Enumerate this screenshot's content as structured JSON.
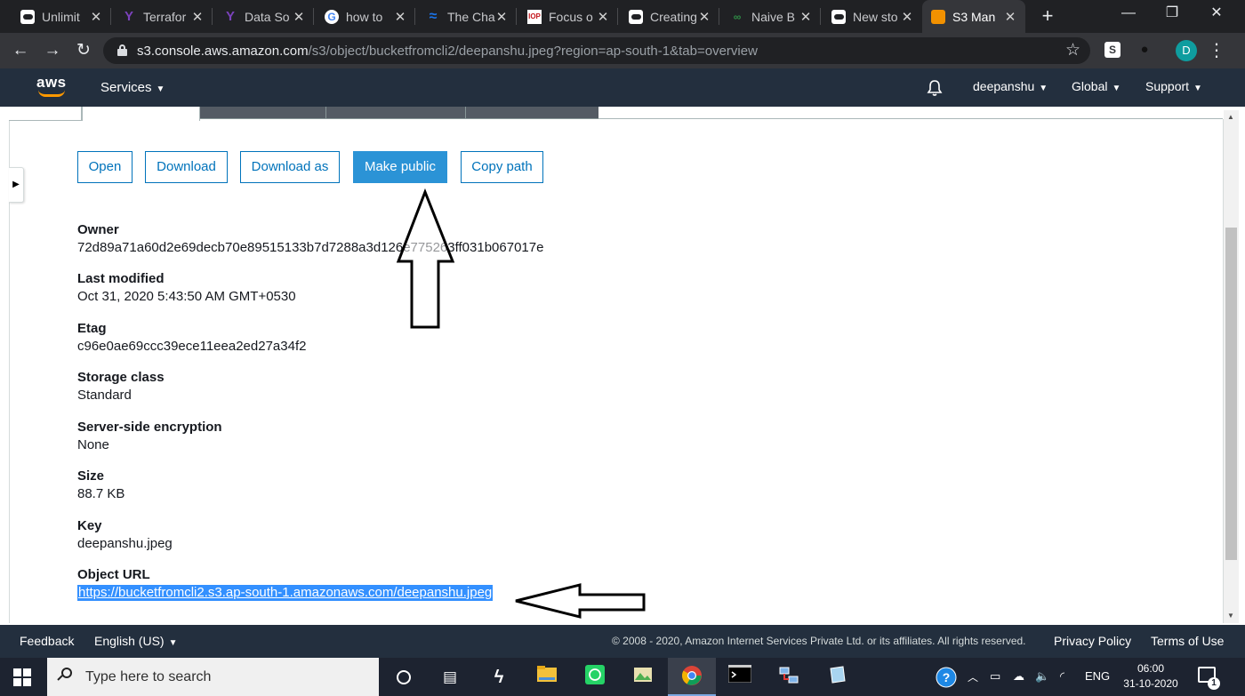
{
  "browser": {
    "tabs": [
      {
        "title": "Unlimit",
        "favicon": "medium-icon"
      },
      {
        "title": "Terrafor",
        "favicon": "terraform-icon"
      },
      {
        "title": "Data So",
        "favicon": "terraform-icon"
      },
      {
        "title": "how to",
        "favicon": "google-icon"
      },
      {
        "title": "The Cha",
        "favicon": "wave-icon"
      },
      {
        "title": "Focus o",
        "favicon": "iop-icon"
      },
      {
        "title": "Creating",
        "favicon": "medium-icon"
      },
      {
        "title": "Naive B",
        "favicon": "gfg-icon"
      },
      {
        "title": "New sto",
        "favicon": "medium-icon"
      },
      {
        "title": "S3 Man",
        "favicon": "s3-icon",
        "active": true
      }
    ],
    "favicon_glyphs": {
      "terraform": "Y",
      "google": "G",
      "wave": "≈",
      "iop": "IOP",
      "gfg": "∞"
    },
    "url_host": "s3.console.aws.amazon.com",
    "url_path": "/s3/object/bucketfromcli2/deepanshu.jpeg?region=ap-south-1&tab=overview",
    "extension_letter": "S",
    "avatar_letter": "D",
    "glyphs": {
      "back": "←",
      "forward": "→",
      "reload": "↻",
      "star": "☆",
      "close": "✕",
      "newtab": "+",
      "minimize": "—",
      "restore": "❐",
      "kebab": "⋮",
      "caret": "▼",
      "bell": "🔔"
    }
  },
  "aws": {
    "logo_text": "aws",
    "nav": {
      "services": "Services",
      "user": "deepanshu",
      "region": "Global",
      "support": "Support"
    },
    "actions": {
      "open": "Open",
      "download": "Download",
      "download_as": "Download as",
      "make_public": "Make public",
      "copy_path": "Copy path"
    },
    "fields": {
      "owner": {
        "label": "Owner",
        "value": "72d89a71a60d2e69decb70e89515133b7d7288a3d126e775263ff031b067017e"
      },
      "last_modified": {
        "label": "Last modified",
        "value": "Oct 31, 2020 5:43:50 AM GMT+0530"
      },
      "etag": {
        "label": "Etag",
        "value": "c96e0ae69ccc39ece11eea2ed27a34f2"
      },
      "storage_class": {
        "label": "Storage class",
        "value": "Standard"
      },
      "encryption": {
        "label": "Server-side encryption",
        "value": "None"
      },
      "size": {
        "label": "Size",
        "value": "88.7 KB"
      },
      "key": {
        "label": "Key",
        "value": "deepanshu.jpeg"
      },
      "object_url": {
        "label": "Object URL",
        "value": "https://bucketfromcli2.s3.ap-south-1.amazonaws.com/deepanshu.jpeg"
      }
    },
    "footer": {
      "feedback": "Feedback",
      "language": "English (US)",
      "copyright": "© 2008 - 2020, Amazon Internet Services Private Ltd. or its affiliates. All rights reserved.",
      "privacy": "Privacy Policy",
      "terms": "Terms of Use"
    },
    "colors": {
      "nav_bg": "#232f3e",
      "accent": "#ff9900",
      "link": "#0073bb",
      "primary_button": "#2b93d6"
    }
  },
  "taskbar": {
    "search_placeholder": "Type here to search",
    "language": "ENG",
    "time": "06:00",
    "date": "31-10-2020",
    "notification_count": "1"
  }
}
